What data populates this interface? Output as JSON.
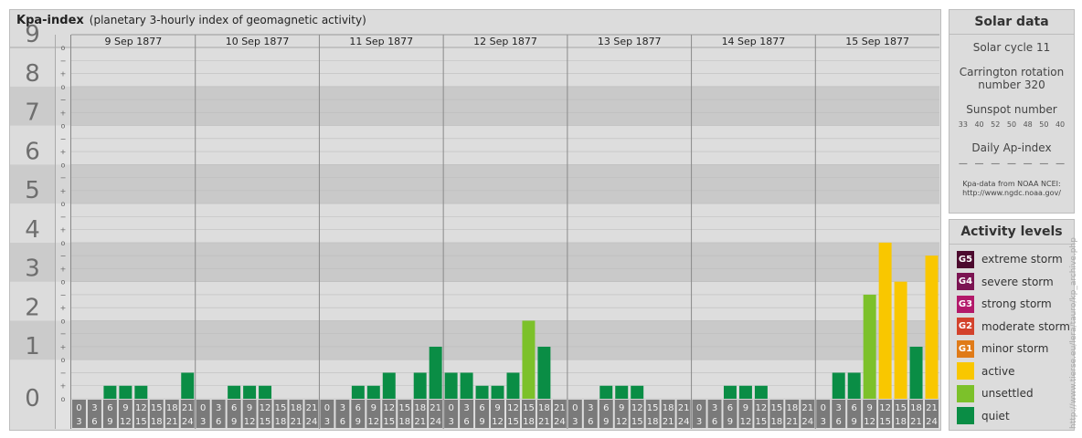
{
  "header": {
    "title": "Kpa-index",
    "subtitle": "(planetary 3-hourly index of geomagnetic activity)"
  },
  "chart_data": {
    "type": "bar",
    "ylim": [
      0,
      9
    ],
    "y_ticks": [
      "0",
      "1",
      "2",
      "3",
      "4",
      "5",
      "6",
      "7",
      "8",
      "9"
    ],
    "sub_ticks": [
      "−",
      "+",
      "o"
    ],
    "days": [
      "9 Sep 1877",
      "10 Sep 1877",
      "11 Sep 1877",
      "12 Sep 1877",
      "13 Sep 1877",
      "14 Sep 1877",
      "15 Sep 1877"
    ],
    "interval_start_labels": [
      "0",
      "3",
      "6",
      "9",
      "12",
      "15",
      "18",
      "21"
    ],
    "interval_end_labels": [
      "3",
      "6",
      "9",
      "12",
      "15",
      "18",
      "21",
      "24"
    ],
    "values": [
      [
        0,
        0,
        0.333,
        0.333,
        0.333,
        0,
        0,
        0.667
      ],
      [
        0,
        0,
        0.333,
        0.333,
        0.333,
        0,
        0,
        0
      ],
      [
        0,
        0,
        0.333,
        0.333,
        0.667,
        0,
        0.667,
        1.333
      ],
      [
        0.667,
        0.667,
        0.333,
        0.333,
        0.667,
        2,
        1.333,
        0
      ],
      [
        0,
        0,
        0.333,
        0.333,
        0.333,
        0,
        0,
        0
      ],
      [
        0,
        0,
        0.333,
        0.333,
        0.333,
        0,
        0,
        0
      ],
      [
        0,
        0.667,
        0.667,
        2.667,
        4,
        3,
        1.333,
        3.667
      ]
    ],
    "colors": {
      "quiet": "#0a8d45",
      "unsettled": "#7cc12a",
      "active": "#f9c700",
      "minor": "#e07b18",
      "moderate": "#d3422c",
      "strong": "#b3196a",
      "severe": "#7b1452",
      "extreme": "#4c0a2e",
      "label_bg": "#7a7a7a"
    }
  },
  "solar": {
    "header": "Solar data",
    "cycle": "Solar cycle 11",
    "carrington_line1": "Carrington rotation",
    "carrington_line2": "number 320",
    "sunspot_label": "Sunspot number",
    "sunspot_values": [
      "33",
      "40",
      "52",
      "50",
      "48",
      "50",
      "40"
    ],
    "ap_label": "Daily Ap-index",
    "ap_values": [
      "—",
      "—",
      "—",
      "—",
      "—",
      "—",
      "—"
    ],
    "source_line1": "Kpa-data from NOAA NCEI:",
    "source_line2": "http://www.ngdc.noaa.gov/"
  },
  "activity": {
    "header": "Activity levels",
    "items": [
      {
        "badge": "G5",
        "label": "extreme storm",
        "color": "#4c0a2e"
      },
      {
        "badge": "G4",
        "label": "severe storm",
        "color": "#7b1452"
      },
      {
        "badge": "G3",
        "label": "strong storm",
        "color": "#b3196a"
      },
      {
        "badge": "G2",
        "label": "moderate storm",
        "color": "#d3422c"
      },
      {
        "badge": "G1",
        "label": "minor storm",
        "color": "#e07b18"
      },
      {
        "badge": "",
        "label": "active",
        "color": "#f9c700"
      },
      {
        "badge": "",
        "label": "unsettled",
        "color": "#7cc12a"
      },
      {
        "badge": "",
        "label": "quiet",
        "color": "#0a8d45"
      }
    ]
  },
  "credit": "http://www.tierse.eu/lera/tauro/kp_archive.php"
}
